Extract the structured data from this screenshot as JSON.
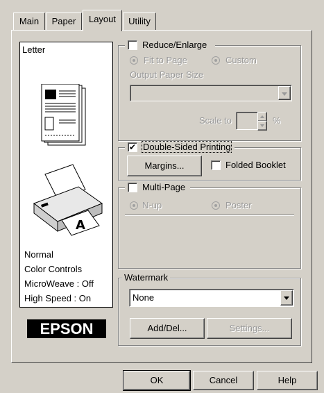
{
  "tabs": [
    {
      "label": "Main"
    },
    {
      "label": "Paper"
    },
    {
      "label": "Layout"
    },
    {
      "label": "Utility"
    }
  ],
  "preview": {
    "paper_label": "Letter",
    "status": [
      "Normal",
      "Color Controls",
      "MicroWeave : Off",
      "High Speed : On"
    ],
    "brand": "EPSON"
  },
  "reduce_enlarge": {
    "label": "Reduce/Enlarge",
    "checked": false,
    "fit_to_page": "Fit to Page",
    "custom": "Custom",
    "output_paper_size": "Output Paper Size",
    "output_paper_value": "",
    "scale_to": "Scale to",
    "scale_value": "",
    "percent": "%"
  },
  "double_sided": {
    "label": "Double-Sided Printing",
    "checked": true,
    "margins_button": "Margins...",
    "folded_booklet": "Folded Booklet",
    "folded_checked": false
  },
  "multi_page": {
    "label": "Multi-Page",
    "checked": false,
    "n_up": "N-up",
    "poster": "Poster"
  },
  "watermark": {
    "label": "Watermark",
    "selected": "None",
    "add_del_button": "Add/Del...",
    "settings_button": "Settings..."
  },
  "footer": {
    "ok": "OK",
    "cancel": "Cancel",
    "help": "Help"
  }
}
